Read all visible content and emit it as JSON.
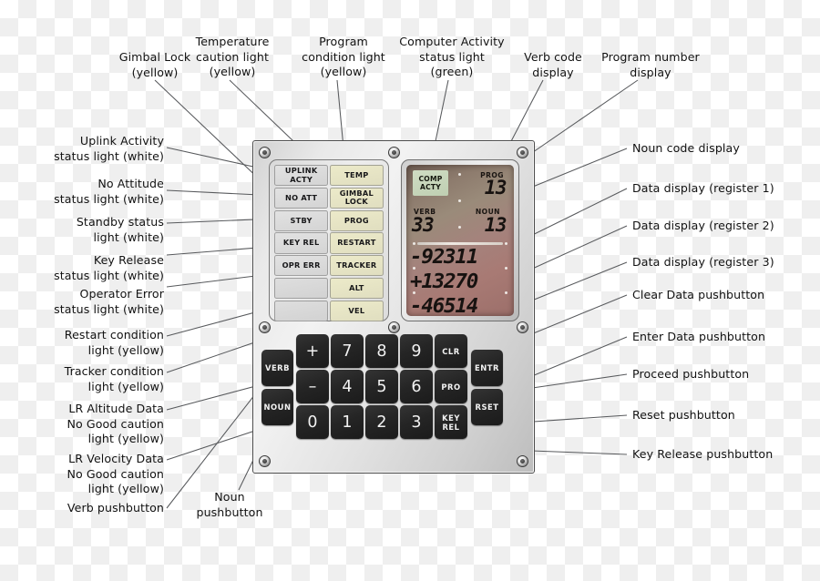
{
  "figure": {
    "title": "Apollo Guidance Computer DSKY (Display and Keyboard) annotated diagram"
  },
  "device": {
    "status_lights": {
      "left_column": [
        {
          "id": "uplink-acty",
          "label": "UPLINK\nACTY",
          "color": "white",
          "hex": "#dcdcdc"
        },
        {
          "id": "no-att",
          "label": "NO ATT",
          "color": "white",
          "hex": "#dcdcdc"
        },
        {
          "id": "stby",
          "label": "STBY",
          "color": "white",
          "hex": "#dcdcdc"
        },
        {
          "id": "key-rel",
          "label": "KEY REL",
          "color": "white",
          "hex": "#dcdcdc"
        },
        {
          "id": "opr-err",
          "label": "OPR ERR",
          "color": "white",
          "hex": "#dcdcdc"
        },
        {
          "id": "blank-1",
          "label": "",
          "color": "blank",
          "hex": "#d6d6d6"
        },
        {
          "id": "blank-2",
          "label": "",
          "color": "blank",
          "hex": "#d6d6d6"
        }
      ],
      "right_column": [
        {
          "id": "temp",
          "label": "TEMP",
          "color": "yellow",
          "hex": "#e6e4c4"
        },
        {
          "id": "gimbal-lock",
          "label": "GIMBAL\nLOCK",
          "color": "yellow",
          "hex": "#e6e4c4"
        },
        {
          "id": "prog",
          "label": "PROG",
          "color": "yellow",
          "hex": "#e6e4c4"
        },
        {
          "id": "restart",
          "label": "RESTART",
          "color": "yellow",
          "hex": "#e6e4c4"
        },
        {
          "id": "tracker",
          "label": "TRACKER",
          "color": "yellow",
          "hex": "#e6e4c4"
        },
        {
          "id": "alt",
          "label": "ALT",
          "color": "yellow",
          "hex": "#e6e4c4"
        },
        {
          "id": "vel",
          "label": "VEL",
          "color": "yellow",
          "hex": "#e6e4c4"
        }
      ]
    },
    "display": {
      "comp_acty": {
        "line1": "COMP",
        "line2": "ACTY",
        "color": "#c6d4bb"
      },
      "prog_caption": "PROG",
      "prog_value": "13",
      "verb_caption": "VERB",
      "verb_value": "33",
      "noun_caption": "NOUN",
      "noun_value": "13",
      "register_1": "-92311",
      "register_2": "+13270",
      "register_3": "-46514",
      "panel_color": "#9a8275"
    },
    "keypad": {
      "side_left": [
        {
          "id": "verb",
          "label": "VERB"
        },
        {
          "id": "noun",
          "label": "NOUN"
        }
      ],
      "main_rows": [
        [
          {
            "id": "plus",
            "label": "+"
          },
          {
            "id": "seven",
            "label": "7"
          },
          {
            "id": "eight",
            "label": "8"
          },
          {
            "id": "nine",
            "label": "9"
          },
          {
            "id": "clr",
            "label": "CLR"
          }
        ],
        [
          {
            "id": "minus",
            "label": "–"
          },
          {
            "id": "four",
            "label": "4"
          },
          {
            "id": "five",
            "label": "5"
          },
          {
            "id": "six",
            "label": "6"
          },
          {
            "id": "pro",
            "label": "PRO"
          }
        ],
        [
          {
            "id": "zero",
            "label": "0"
          },
          {
            "id": "one",
            "label": "1"
          },
          {
            "id": "two",
            "label": "2"
          },
          {
            "id": "three",
            "label": "3"
          },
          {
            "id": "key-rel",
            "label": "KEY\nREL"
          }
        ]
      ],
      "side_right": [
        {
          "id": "entr",
          "label": "ENTR"
        },
        {
          "id": "rset",
          "label": "RSET"
        }
      ]
    }
  },
  "annotations": {
    "top": [
      {
        "id": "gimbal-lock",
        "text": "Gimbal Lock\n(yellow)"
      },
      {
        "id": "temperature",
        "text": "Temperature\ncaution light\n(yellow)"
      },
      {
        "id": "program-condition",
        "text": "Program\ncondition light\n(yellow)"
      },
      {
        "id": "computer-activity",
        "text": "Computer Activity\nstatus light\n(green)"
      },
      {
        "id": "verb-code",
        "text": "Verb code\ndisplay"
      },
      {
        "id": "program-number",
        "text": "Program number\ndisplay"
      }
    ],
    "left": [
      {
        "id": "uplink-activity",
        "text": "Uplink Activity\nstatus light (white)"
      },
      {
        "id": "no-attitude",
        "text": "No Attitude\nstatus light (white)"
      },
      {
        "id": "standby",
        "text": "Standby status\nlight (white)"
      },
      {
        "id": "key-release",
        "text": "Key Release\nstatus light (white)"
      },
      {
        "id": "operator-error",
        "text": "Operator Error\nstatus light (white)"
      },
      {
        "id": "restart",
        "text": "Restart condition\nlight (yellow)"
      },
      {
        "id": "tracker",
        "text": "Tracker condition\nlight (yellow)"
      },
      {
        "id": "lr-altitude",
        "text": "LR Altitude Data\nNo Good caution\nlight (yellow)"
      },
      {
        "id": "lr-velocity",
        "text": "LR Velocity Data\nNo Good caution\nlight (yellow)"
      },
      {
        "id": "verb-pushbutton",
        "text": "Verb pushbutton"
      }
    ],
    "bottom": [
      {
        "id": "noun-pushbutton",
        "text": "Noun\npushbutton"
      }
    ],
    "right": [
      {
        "id": "noun-code",
        "text": "Noun code display"
      },
      {
        "id": "data-register-1",
        "text": "Data display (register 1)"
      },
      {
        "id": "data-register-2",
        "text": "Data display (register 2)"
      },
      {
        "id": "data-register-3",
        "text": "Data display (register 3)"
      },
      {
        "id": "clear-data",
        "text": "Clear Data pushbutton"
      },
      {
        "id": "enter-data",
        "text": "Enter Data pushbutton"
      },
      {
        "id": "proceed",
        "text": "Proceed pushbutton"
      },
      {
        "id": "reset",
        "text": "Reset pushbutton"
      },
      {
        "id": "key-release-btn",
        "text": "Key Release pushbutton"
      }
    ]
  }
}
